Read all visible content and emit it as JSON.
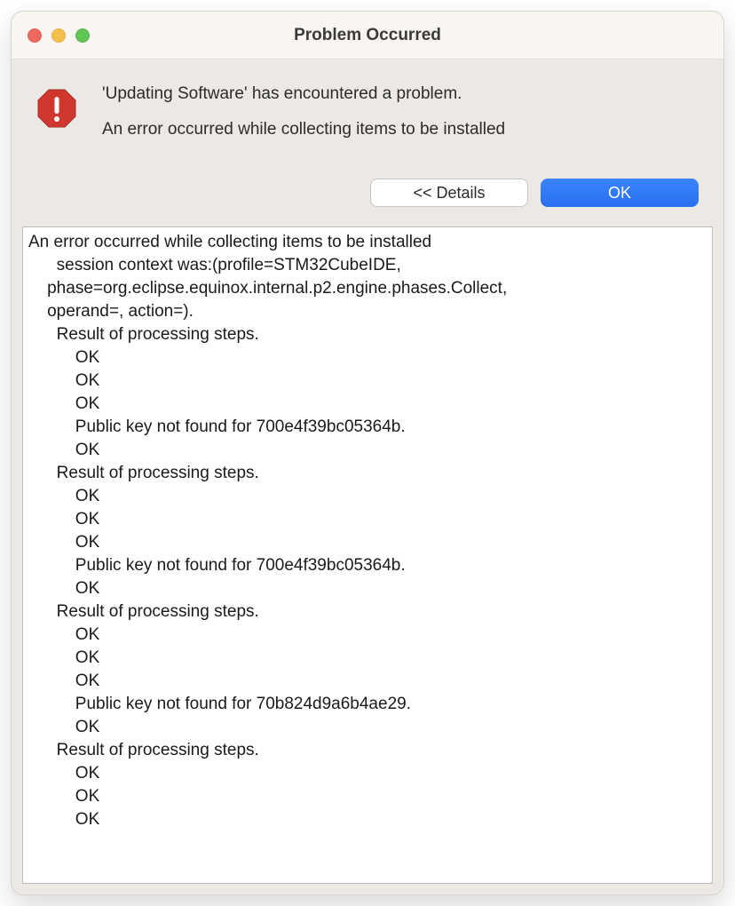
{
  "window": {
    "title": "Problem Occurred"
  },
  "message": {
    "headline": "'Updating Software' has encountered a problem.",
    "subtext": "An error occurred while collecting items to be installed"
  },
  "buttons": {
    "details_label": "<< Details",
    "ok_label": "OK"
  },
  "details_text": "An error occurred while collecting items to be installed\n      session context was:(profile=STM32CubeIDE,\n    phase=org.eclipse.equinox.internal.p2.engine.phases.Collect,\n    operand=, action=).\n      Result of processing steps.\n          OK\n          OK\n          OK\n          Public key not found for 700e4f39bc05364b.\n          OK\n      Result of processing steps.\n          OK\n          OK\n          OK\n          Public key not found for 700e4f39bc05364b.\n          OK\n      Result of processing steps.\n          OK\n          OK\n          OK\n          Public key not found for 70b824d9a6b4ae29.\n          OK\n      Result of processing steps.\n          OK\n          OK\n          OK"
}
